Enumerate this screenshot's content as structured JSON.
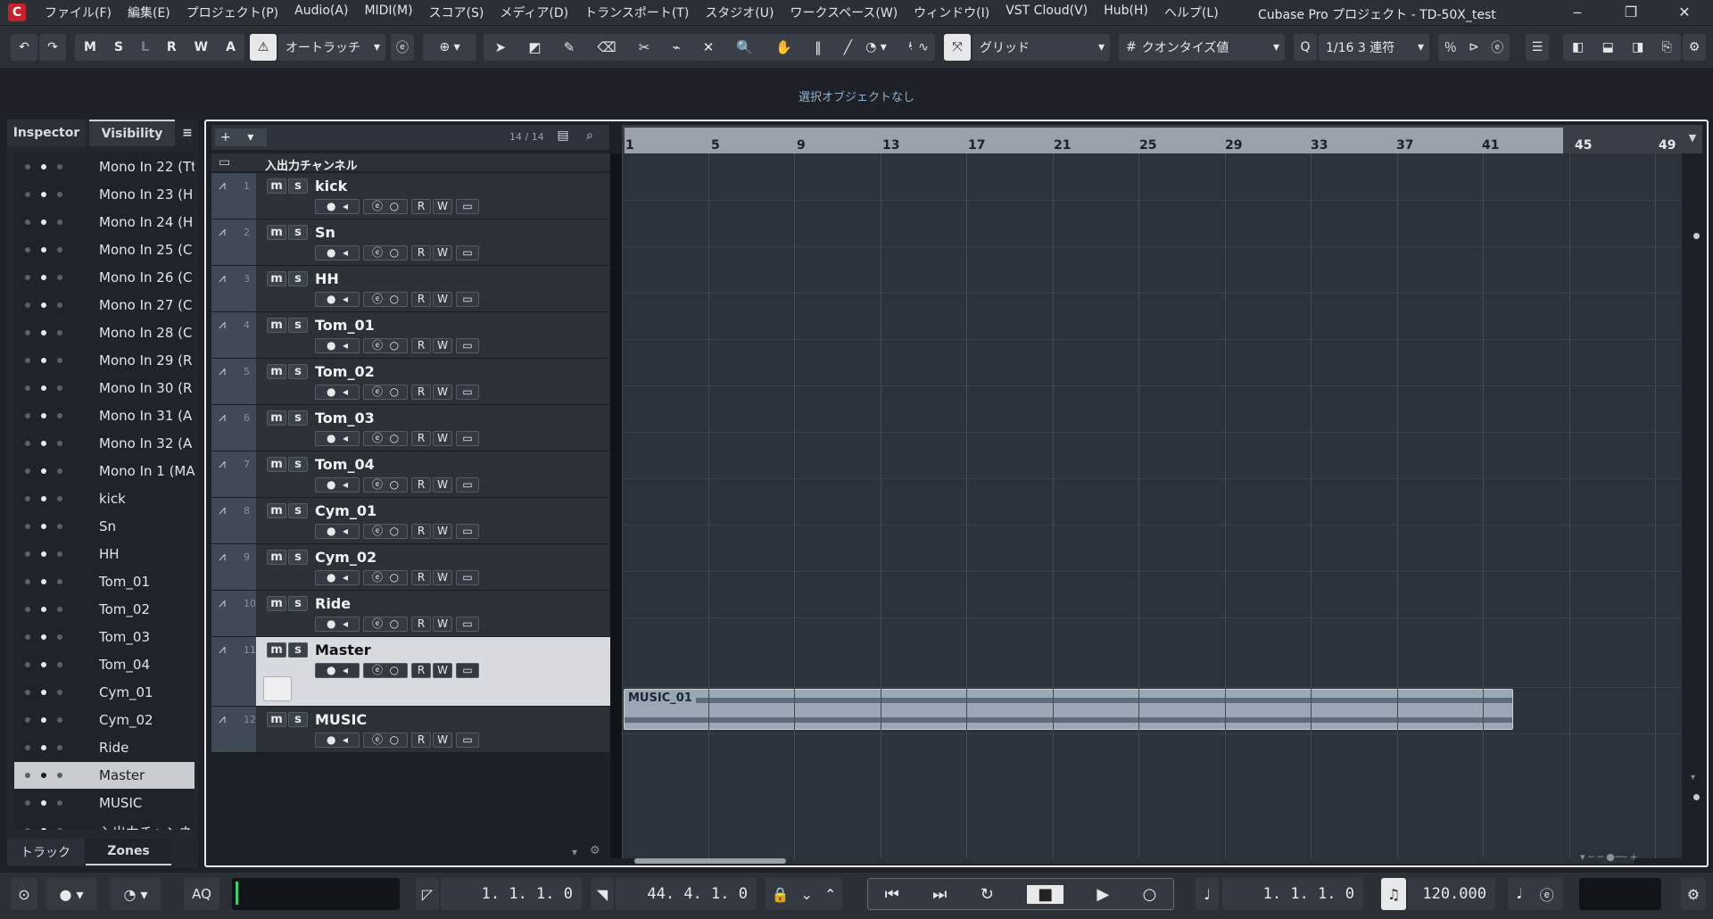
{
  "app": {
    "logo_letter": "C",
    "window_title": "Cubase Pro プロジェクト - TD-50X_test",
    "menu": [
      "ファイル(F)",
      "編集(E)",
      "プロジェクト(P)",
      "Audio(A)",
      "MIDI(M)",
      "スコア(S)",
      "メディア(D)",
      "トランスポート(T)",
      "スタジオ(U)",
      "ワークスペース(W)",
      "ウィンドウ(I)",
      "VST Cloud(V)",
      "Hub(H)",
      "ヘルプ(L)"
    ],
    "win_controls": [
      "‒",
      "❐",
      "✕"
    ]
  },
  "toolbar": {
    "undo": "↶",
    "redo": "↷",
    "mswra": [
      "M",
      "S",
      "L",
      "R",
      "W",
      "A"
    ],
    "automation_label": "オートラッチ",
    "grid_label": "グリッド",
    "quantize_label": "クオンタイズ値",
    "quantize_value": "1/16 3 連符",
    "snap_icon": "#",
    "q_icon": "Q"
  },
  "info_line": "選択オブジェクトなし",
  "left_zone": {
    "tabs": [
      "Inspector",
      "Visibility"
    ],
    "bottom_tabs": [
      "トラック",
      "Zones"
    ],
    "visibility_items": [
      "Mono In 22 (Tt",
      "Mono In 23 (H",
      "Mono In 24 (H",
      "Mono In 25 (C",
      "Mono In 26 (C",
      "Mono In 27 (C",
      "Mono In 28 (C",
      "Mono In 29 (R",
      "Mono In 30 (R",
      "Mono In 31 (A",
      "Mono In 32 (A",
      "Mono In 1 (MA",
      "kick",
      "Sn",
      "HH",
      "Tom_01",
      "Tom_02",
      "Tom_03",
      "Tom_04",
      "Cym_01",
      "Cym_02",
      "Ride",
      "Master",
      "MUSIC",
      "入出力チャンネル"
    ],
    "selected_item": "Master"
  },
  "track_list": {
    "count_label": "14 / 14",
    "add_label": "+",
    "folder_name": "入出力チャンネル",
    "tracks": [
      {
        "num": "1",
        "name": "kick"
      },
      {
        "num": "2",
        "name": "Sn"
      },
      {
        "num": "3",
        "name": "HH"
      },
      {
        "num": "4",
        "name": "Tom_01"
      },
      {
        "num": "5",
        "name": "Tom_02"
      },
      {
        "num": "6",
        "name": "Tom_03"
      },
      {
        "num": "7",
        "name": "Tom_04"
      },
      {
        "num": "8",
        "name": "Cym_01"
      },
      {
        "num": "9",
        "name": "Cym_02"
      },
      {
        "num": "10",
        "name": "Ride"
      },
      {
        "num": "11",
        "name": "Master"
      },
      {
        "num": "12",
        "name": "MUSIC"
      }
    ],
    "track_buttons": {
      "mute": "m",
      "solo": "s",
      "read": "R",
      "write": "W"
    }
  },
  "ruler": {
    "bars": [
      "1",
      "5",
      "9",
      "13",
      "17",
      "21",
      "25",
      "29",
      "33",
      "37",
      "41",
      "45",
      "49"
    ]
  },
  "event": {
    "name": "MUSIC_01"
  },
  "transport": {
    "aq_label": "AQ",
    "left_locator": "1. 1. 1. 0",
    "right_locator": "44. 4. 1. 0",
    "position": "1. 1. 1. 0",
    "tempo": "120.000"
  }
}
